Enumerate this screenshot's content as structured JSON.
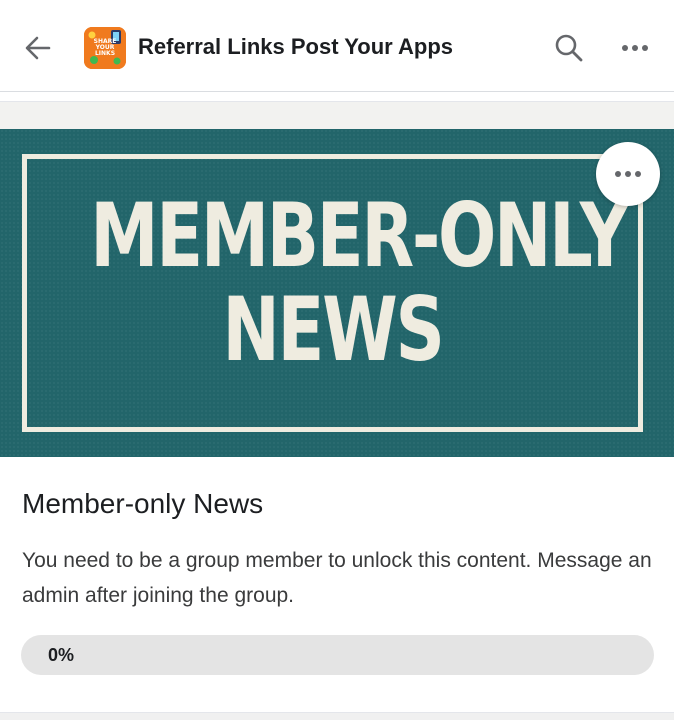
{
  "header": {
    "title": "Referral Links Post Your Apps",
    "avatar_text": "SHARE YOUR LINKS",
    "icons": {
      "back": "arrow-left-icon",
      "search": "search-icon",
      "more": "more-horizontal-icon"
    }
  },
  "banner": {
    "line1": "MEMBER-ONLY",
    "line2": "NEWS",
    "background_color": "#22656a",
    "text_color": "#efece0",
    "more_icon": "more-horizontal-icon"
  },
  "post": {
    "title": "Member-only News",
    "body": "You need to be a group member to unlock this content. Message an admin after joining the group."
  },
  "progress": {
    "label": "0%",
    "value": 0
  },
  "colors": {
    "accent": "#1877f2",
    "progress_track": "#e4e4e4"
  }
}
